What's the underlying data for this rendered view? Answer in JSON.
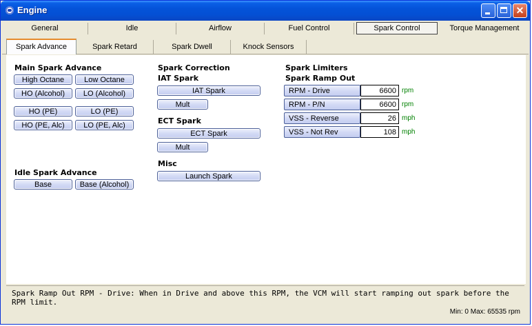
{
  "window": {
    "title": "Engine"
  },
  "tabs_main": [
    "General",
    "Idle",
    "Airflow",
    "Fuel Control",
    "Spark Control",
    "Torque Management"
  ],
  "tabs_main_active": "Spark Control",
  "tabs_sub": [
    "Spark Advance",
    "Spark Retard",
    "Spark Dwell",
    "Knock Sensors"
  ],
  "tabs_sub_active": "Spark Advance",
  "main_spark": {
    "title": "Main Spark Advance",
    "buttons": [
      "High Octane",
      "Low Octane",
      "HO (Alcohol)",
      "LO (Alcohol)",
      "HO (PE)",
      "LO (PE)",
      "HO (PE, Alc)",
      "LO (PE, Alc)"
    ]
  },
  "idle_spark": {
    "title": "Idle Spark Advance",
    "buttons": [
      "Base",
      "Base (Alcohol)"
    ]
  },
  "spark_correction": {
    "title": "Spark Correction",
    "iat_title": "IAT Spark",
    "iat_button": "IAT Spark",
    "iat_mult": "Mult",
    "ect_title": "ECT Spark",
    "ect_button": "ECT Spark",
    "ect_mult": "Mult",
    "misc_title": "Misc",
    "launch_button": "Launch Spark"
  },
  "spark_limiters": {
    "title": "Spark Limiters",
    "subtitle": "Spark Ramp Out",
    "rows": [
      {
        "label": "RPM - Drive",
        "value": "6600",
        "unit": "rpm"
      },
      {
        "label": "RPM - P/N",
        "value": "6600",
        "unit": "rpm"
      },
      {
        "label": "VSS - Reverse",
        "value": "26",
        "unit": "mph"
      },
      {
        "label": "VSS - Not Rev",
        "value": "108",
        "unit": "mph"
      }
    ]
  },
  "status": {
    "description": "Spark Ramp Out RPM - Drive: When in Drive and above this RPM, the VCM will start ramping out spark before the RPM limit.",
    "range": "Min: 0 Max: 65535 rpm"
  },
  "colors": {
    "titlebar": "#0453d9",
    "unit_text": "#008000",
    "tab_highlight": "#e68b2c"
  }
}
